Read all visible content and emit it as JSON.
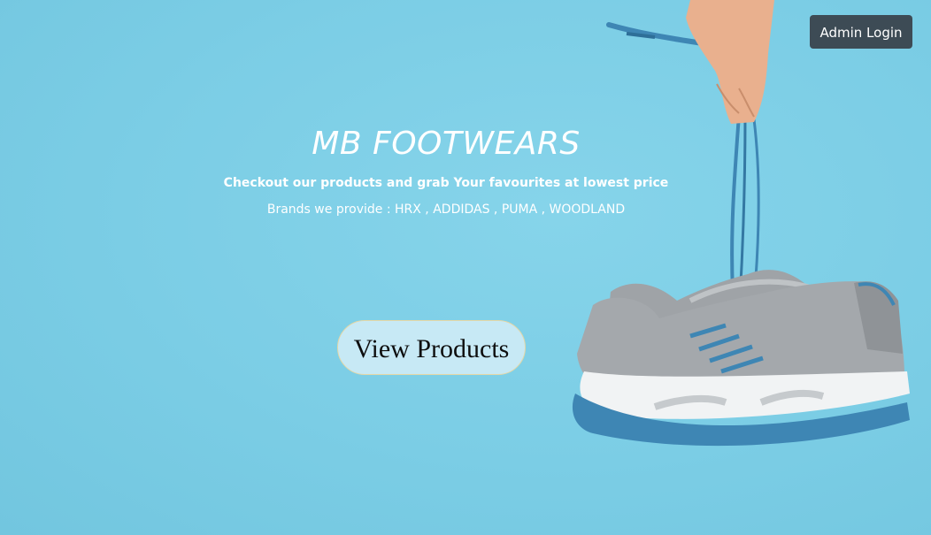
{
  "header": {
    "admin_login_label": "Admin Login"
  },
  "hero": {
    "title": "MB FOOTWEARS",
    "tagline": "Checkout our products and grab Your favourites at lowest price",
    "brands_text": "Brands we provide : HRX , ADDIDAS , PUMA , WOODLAND",
    "view_products_label": "View Products"
  },
  "colors": {
    "background": "#7dcfe6",
    "admin_button": "#3d4b55",
    "view_button": "#c7e9f5",
    "shoe_grey": "#9b9fa3",
    "shoe_blue": "#3e86b4"
  },
  "images": {
    "hero_image": "hand holding pair of grey and blue running shoes by laces"
  }
}
